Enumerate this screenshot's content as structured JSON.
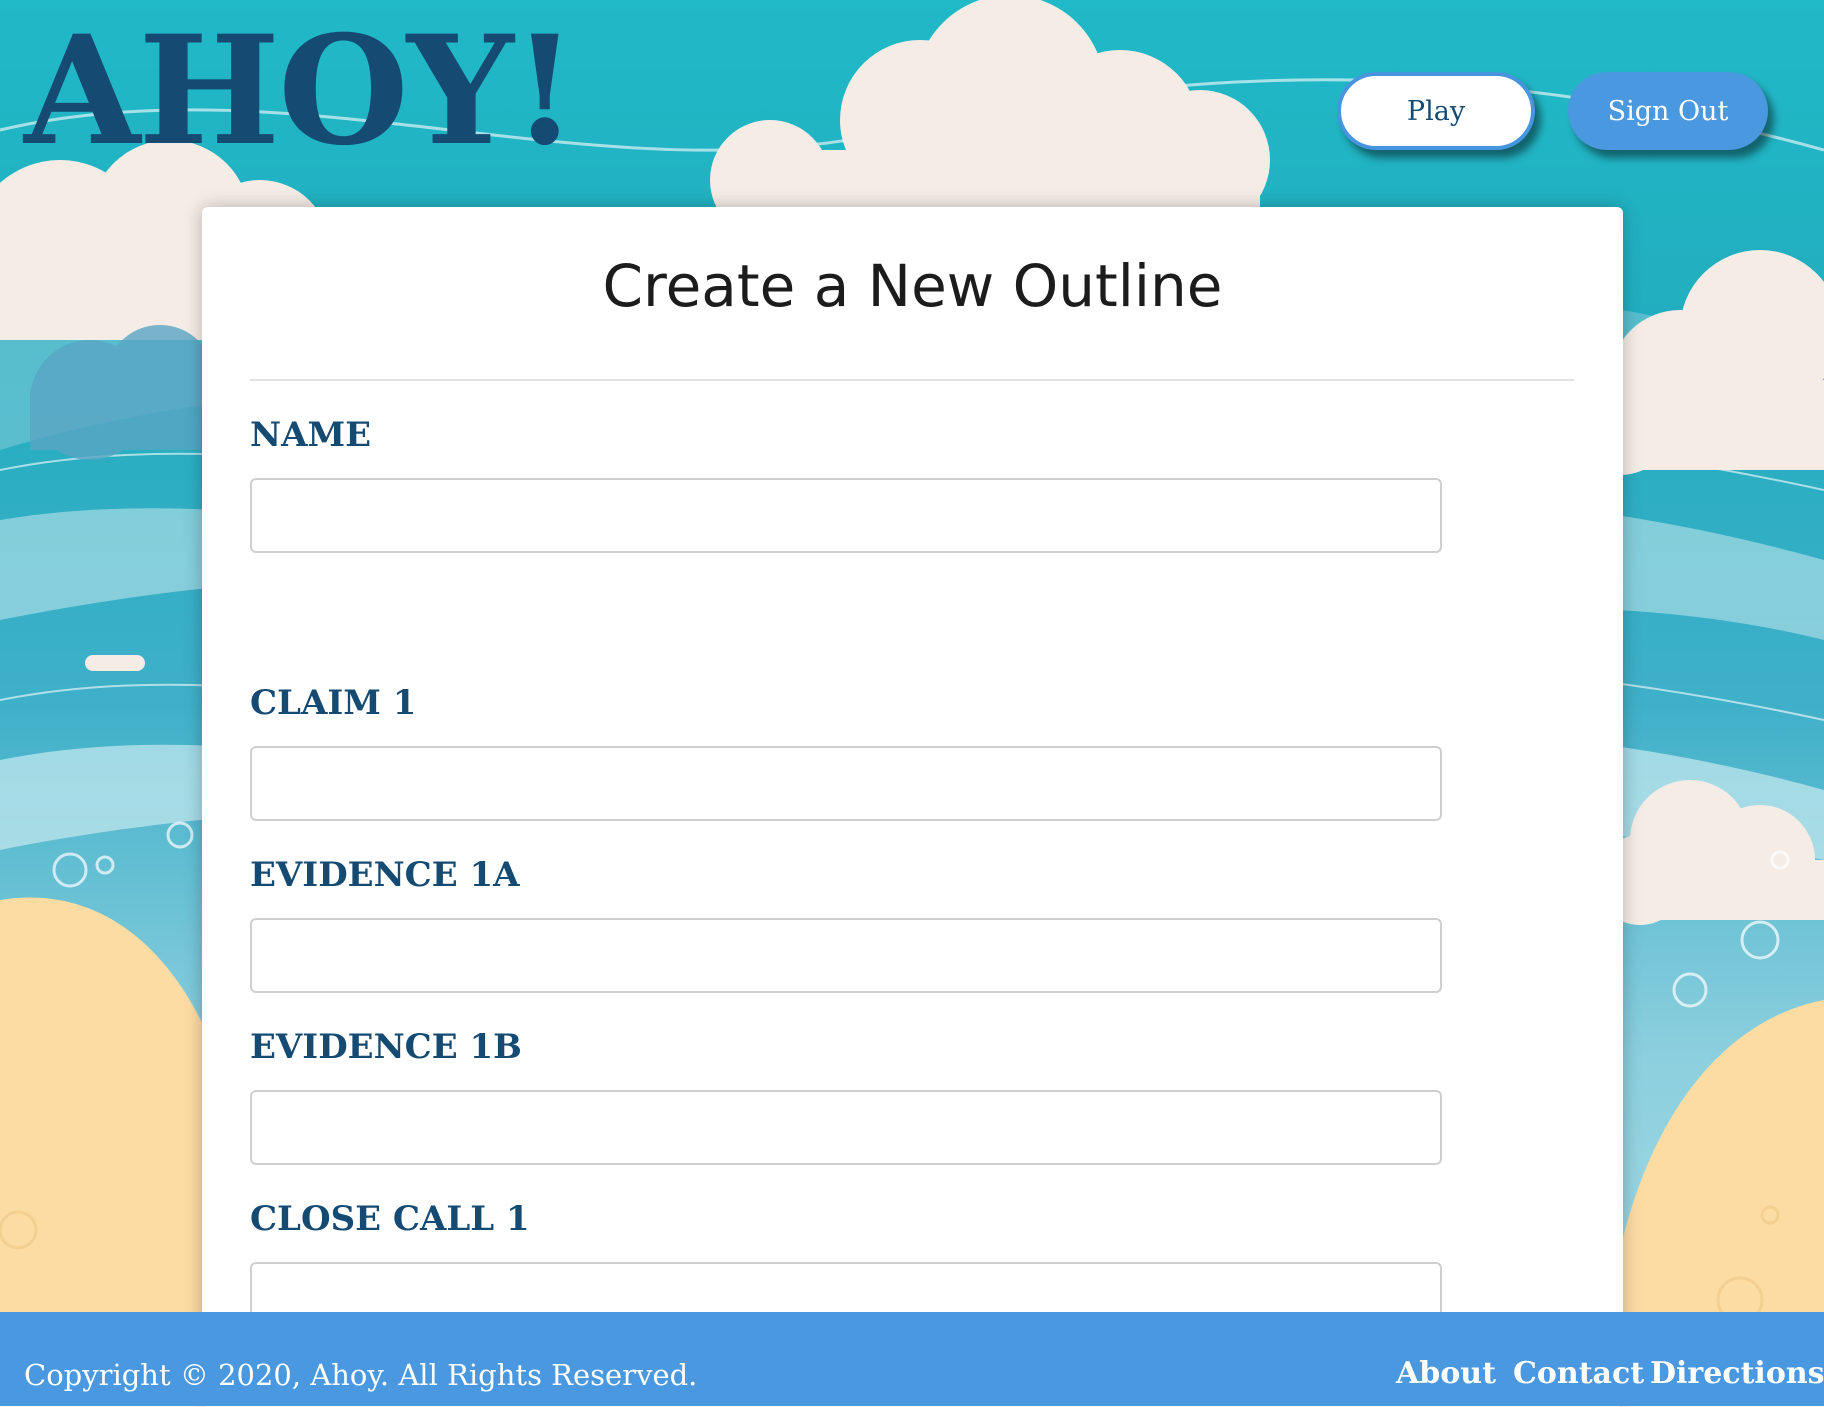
{
  "header": {
    "logo": "AHOY!",
    "buttons": {
      "play_label": "Play",
      "signout_label": "Sign Out"
    }
  },
  "form": {
    "title": "Create a New Outline",
    "fields": [
      {
        "label": "NAME",
        "value": ""
      },
      {
        "label": "CLAIM 1",
        "value": ""
      },
      {
        "label": "EVIDENCE 1A",
        "value": ""
      },
      {
        "label": "EVIDENCE 1B",
        "value": ""
      },
      {
        "label": "CLOSE CALL 1",
        "value": ""
      }
    ]
  },
  "footer": {
    "copyright": "Copyright © 2020, Ahoy. All Rights Reserved.",
    "links": [
      "About",
      "Contact",
      "Directions"
    ]
  },
  "colors": {
    "brand_navy": "#154a73",
    "accent_blue": "#4a98e0",
    "sea_teal": "#20b8c6",
    "cloud": "#f6ece6",
    "sand": "#fddca4"
  },
  "icons": {
    "background": "ocean-beach-illustration"
  }
}
